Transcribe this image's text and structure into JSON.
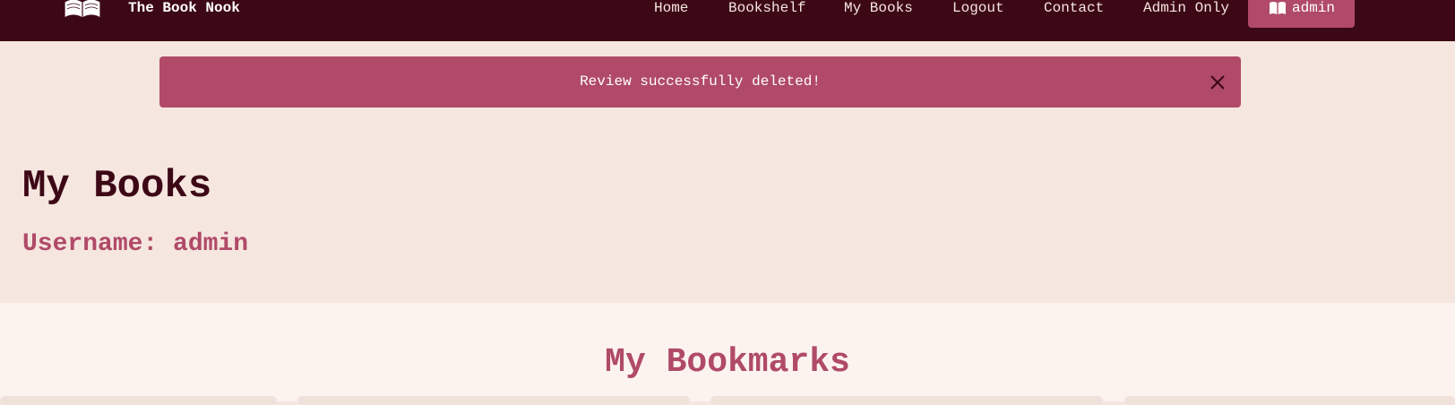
{
  "navbar": {
    "brand": "The Book Nook",
    "links": [
      "Home",
      "Bookshelf",
      "My Books",
      "Logout",
      "Contact",
      "Admin Only"
    ],
    "user_button": "admin"
  },
  "alert": {
    "message": "Review successfully deleted!"
  },
  "profile": {
    "title": "My Books",
    "username_line": "Username: admin"
  },
  "bookmarks": {
    "title": "My Bookmarks"
  },
  "colors": {
    "navbar": "#3d0816",
    "accent": "#b04a68",
    "page_bg": "#f5e6df",
    "section_bg": "#fcf3ef"
  },
  "icons": [
    "open-book-logo-icon",
    "book-icon",
    "close-icon"
  ]
}
